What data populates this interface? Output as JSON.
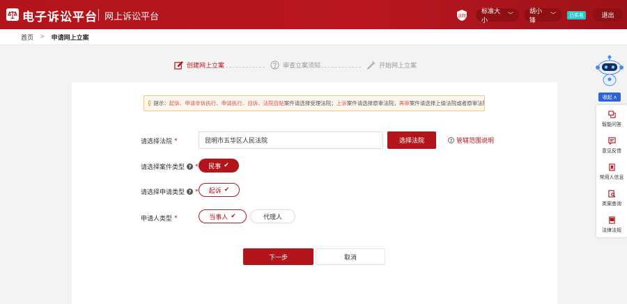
{
  "header": {
    "logo_text": "电子诉讼平台",
    "sub_title": "网上诉讼平台",
    "court_icon_label": "法院",
    "size_selector": "标准大小",
    "user_name": "胡小锋",
    "verified_badge": "已实名",
    "exit_label": "退出"
  },
  "breadcrumb": {
    "home": "首页",
    "current": "申请网上立案"
  },
  "steps": [
    {
      "label": "创建网上立案",
      "icon": "edit-icon",
      "active": true
    },
    {
      "label": "审查立案须知",
      "icon": "question-icon",
      "active": false
    },
    {
      "label": "开始网上立案",
      "icon": "pen-icon",
      "active": false
    }
  ],
  "notice": {
    "prefix": "提示：",
    "part1_hl": "起诉、申请非诉执行、申请执行、自诉、法院自贴",
    "part1": "案件请选择受理法院；",
    "part2_hl": "上诉",
    "part2": "案件请选择原审法院，",
    "part3_hl": "再审",
    "part3": "案件请选择上级法院或者原审法院。"
  },
  "form": {
    "court_label": "请选择法院",
    "court_value": "昆明市五华区人民法院",
    "select_court_button": "选择法院",
    "scope_link": "管辖范围说明",
    "case_type_label": "请选择案件类型",
    "case_type_selected": "民事",
    "apply_type_label": "请选择申请类型",
    "apply_type_selected": "起诉",
    "party_type_label": "申请人类型",
    "party_options": [
      "当事人",
      "代理人"
    ],
    "required_mark": "*"
  },
  "actions": {
    "next": "下一步",
    "cancel": "取消"
  },
  "side_panel": {
    "collapse_label": "收起",
    "items": [
      {
        "label": "智能问答",
        "icon": "chat-icon"
      },
      {
        "label": "意见反馈",
        "icon": "feedback-icon"
      },
      {
        "label": "常用人信息",
        "icon": "contact-icon"
      },
      {
        "label": "类案查询",
        "icon": "search-doc-icon"
      },
      {
        "label": "法律法规",
        "icon": "law-book-icon"
      }
    ]
  },
  "colors": {
    "brand_red": "#b3151c",
    "header_dark_red": "#8e0f14",
    "verified_teal": "#2ec7c9",
    "collapse_blue": "#2d63d8",
    "notice_bg": "#fdf6ec",
    "notice_border": "#f0c78a"
  }
}
